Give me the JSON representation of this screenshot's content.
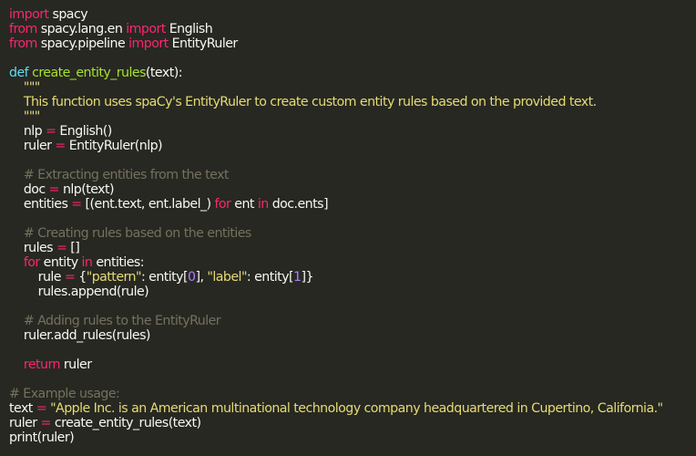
{
  "code": {
    "language": "python",
    "lines": [
      [
        {
          "t": "import",
          "c": "kw"
        },
        {
          "t": " spacy",
          "c": "p"
        }
      ],
      [
        {
          "t": "from",
          "c": "kw"
        },
        {
          "t": " spacy.lang.en ",
          "c": "p"
        },
        {
          "t": "import",
          "c": "kw"
        },
        {
          "t": " English",
          "c": "p"
        }
      ],
      [
        {
          "t": "from",
          "c": "kw"
        },
        {
          "t": " spacy.pipeline ",
          "c": "p"
        },
        {
          "t": "import",
          "c": "kw"
        },
        {
          "t": " EntityRuler",
          "c": "p"
        }
      ],
      [],
      [
        {
          "t": "def",
          "c": "def"
        },
        {
          "t": " ",
          "c": "p"
        },
        {
          "t": "create_entity_rules",
          "c": "fn"
        },
        {
          "t": "(text):",
          "c": "p"
        }
      ],
      [
        {
          "t": "    \"\"\"",
          "c": "str"
        }
      ],
      [
        {
          "t": "    This function uses spaCy's EntityRuler to create custom entity rules based on the provided text.",
          "c": "str"
        }
      ],
      [
        {
          "t": "    \"\"\"",
          "c": "str"
        }
      ],
      [
        {
          "t": "    nlp ",
          "c": "p"
        },
        {
          "t": "=",
          "c": "kw"
        },
        {
          "t": " English()",
          "c": "p"
        }
      ],
      [
        {
          "t": "    ruler ",
          "c": "p"
        },
        {
          "t": "=",
          "c": "kw"
        },
        {
          "t": " EntityRuler(nlp)",
          "c": "p"
        }
      ],
      [],
      [
        {
          "t": "    # Extracting entities from the text",
          "c": "cm"
        }
      ],
      [
        {
          "t": "    doc ",
          "c": "p"
        },
        {
          "t": "=",
          "c": "kw"
        },
        {
          "t": " nlp(text)",
          "c": "p"
        }
      ],
      [
        {
          "t": "    entities ",
          "c": "p"
        },
        {
          "t": "=",
          "c": "kw"
        },
        {
          "t": " [(ent.text, ent.label_) ",
          "c": "p"
        },
        {
          "t": "for",
          "c": "kw"
        },
        {
          "t": " ent ",
          "c": "p"
        },
        {
          "t": "in",
          "c": "kw"
        },
        {
          "t": " doc.ents]",
          "c": "p"
        }
      ],
      [],
      [
        {
          "t": "    # Creating rules based on the entities",
          "c": "cm"
        }
      ],
      [
        {
          "t": "    rules ",
          "c": "p"
        },
        {
          "t": "=",
          "c": "kw"
        },
        {
          "t": " []",
          "c": "p"
        }
      ],
      [
        {
          "t": "    ",
          "c": "p"
        },
        {
          "t": "for",
          "c": "kw"
        },
        {
          "t": " entity ",
          "c": "p"
        },
        {
          "t": "in",
          "c": "kw"
        },
        {
          "t": " entities:",
          "c": "p"
        }
      ],
      [
        {
          "t": "        rule ",
          "c": "p"
        },
        {
          "t": "=",
          "c": "kw"
        },
        {
          "t": " {",
          "c": "p"
        },
        {
          "t": "\"pattern\"",
          "c": "str"
        },
        {
          "t": ": entity[",
          "c": "p"
        },
        {
          "t": "0",
          "c": "num"
        },
        {
          "t": "], ",
          "c": "p"
        },
        {
          "t": "\"label\"",
          "c": "str"
        },
        {
          "t": ": entity[",
          "c": "p"
        },
        {
          "t": "1",
          "c": "num"
        },
        {
          "t": "]}",
          "c": "p"
        }
      ],
      [
        {
          "t": "        rules.append(rule)",
          "c": "p"
        }
      ],
      [],
      [
        {
          "t": "    # Adding rules to the EntityRuler",
          "c": "cm"
        }
      ],
      [
        {
          "t": "    ruler.add_rules(rules)",
          "c": "p"
        }
      ],
      [],
      [
        {
          "t": "    ",
          "c": "p"
        },
        {
          "t": "return",
          "c": "kw"
        },
        {
          "t": " ruler",
          "c": "p"
        }
      ],
      [],
      [
        {
          "t": "# Example usage:",
          "c": "cm"
        }
      ],
      [
        {
          "t": "text ",
          "c": "p"
        },
        {
          "t": "=",
          "c": "kw"
        },
        {
          "t": " ",
          "c": "p"
        },
        {
          "t": "\"Apple Inc. is an American multinational technology company headquartered in Cupertino, California.\"",
          "c": "str"
        }
      ],
      [
        {
          "t": "ruler ",
          "c": "p"
        },
        {
          "t": "=",
          "c": "kw"
        },
        {
          "t": " create_entity_rules(text)",
          "c": "p"
        }
      ],
      [
        {
          "t": "print(ruler)",
          "c": "p"
        }
      ]
    ]
  }
}
